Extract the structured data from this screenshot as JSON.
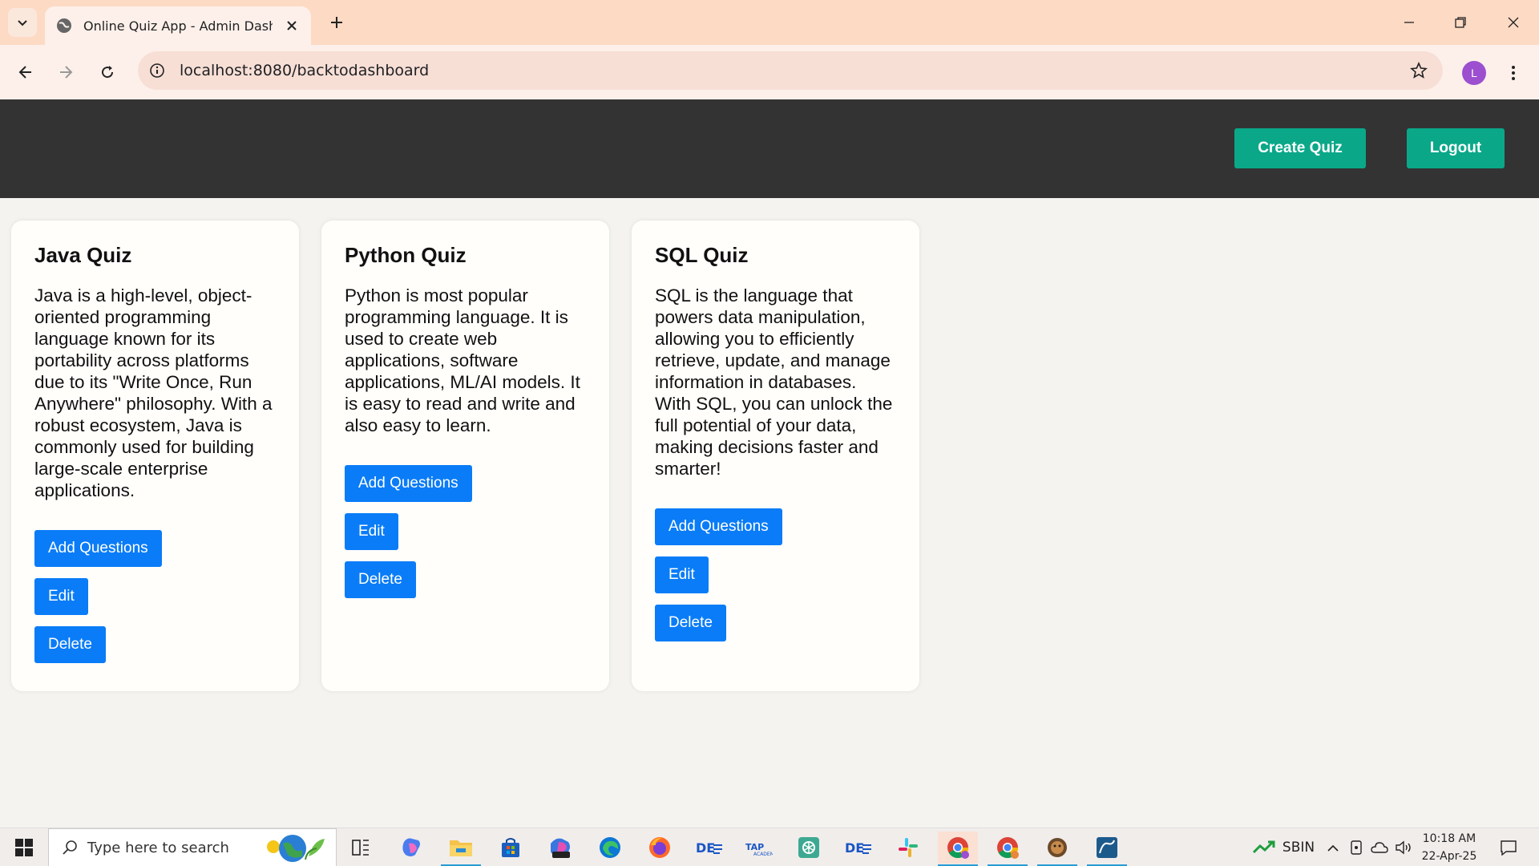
{
  "browser": {
    "tab_title": "Online Quiz App - Admin Dashboard",
    "url": "localhost:8080/backtodashboard",
    "profile_initial": "L",
    "colors": {
      "tabstrip": "#fddac4",
      "toolbar": "#fdf0ea"
    },
    "icons": [
      "tab-search-icon",
      "globe-icon",
      "close-icon",
      "plus-icon",
      "minimize-icon",
      "restore-icon",
      "window-close-icon",
      "back-icon",
      "forward-icon",
      "reload-icon",
      "info-icon",
      "star-icon",
      "kebab-menu-icon"
    ]
  },
  "header": {
    "create_quiz_label": "Create Quiz",
    "logout_label": "Logout",
    "colors": {
      "background": "#333333",
      "button": "#0aa889"
    }
  },
  "quizzes": [
    {
      "title": "Java Quiz",
      "description": "Java is a high-level, object-oriented programming language known for its portability across platforms due to its \"Write Once, Run Anywhere\" philosophy. With a robust ecosystem, Java is commonly used for building large-scale enterprise applications.",
      "add_label": "Add Questions",
      "edit_label": "Edit",
      "delete_label": "Delete"
    },
    {
      "title": "Python Quiz",
      "description": "Python is most popular programming language. It is used to create web applications, software applications, ML/AI models. It is easy to read and write and also easy to learn.",
      "add_label": "Add Questions",
      "edit_label": "Edit",
      "delete_label": "Delete"
    },
    {
      "title": "SQL Quiz",
      "description": "SQL is the language that powers data manipulation, allowing you to efficiently retrieve, update, and manage information in databases. With SQL, you can unlock the full potential of your data, making decisions faster and smarter!",
      "add_label": "Add Questions",
      "edit_label": "Edit",
      "delete_label": "Delete"
    }
  ],
  "card_button_color": "#0a7cf7",
  "taskbar": {
    "search_placeholder": "Type here to search",
    "stock_ticker": "SBIN",
    "time": "10:18 AM",
    "date": "22-Apr-25",
    "apps": [
      "task-view-icon",
      "copilot-icon",
      "file-explorer-icon",
      "microsoft-store-icon",
      "m365-icon",
      "edge-icon",
      "firefox-icon",
      "app-icon",
      "app-icon",
      "chatgpt-icon",
      "app-icon",
      "slack-icon",
      "chrome-icon",
      "chrome-icon",
      "app-icon",
      "mysql-workbench-icon"
    ]
  }
}
